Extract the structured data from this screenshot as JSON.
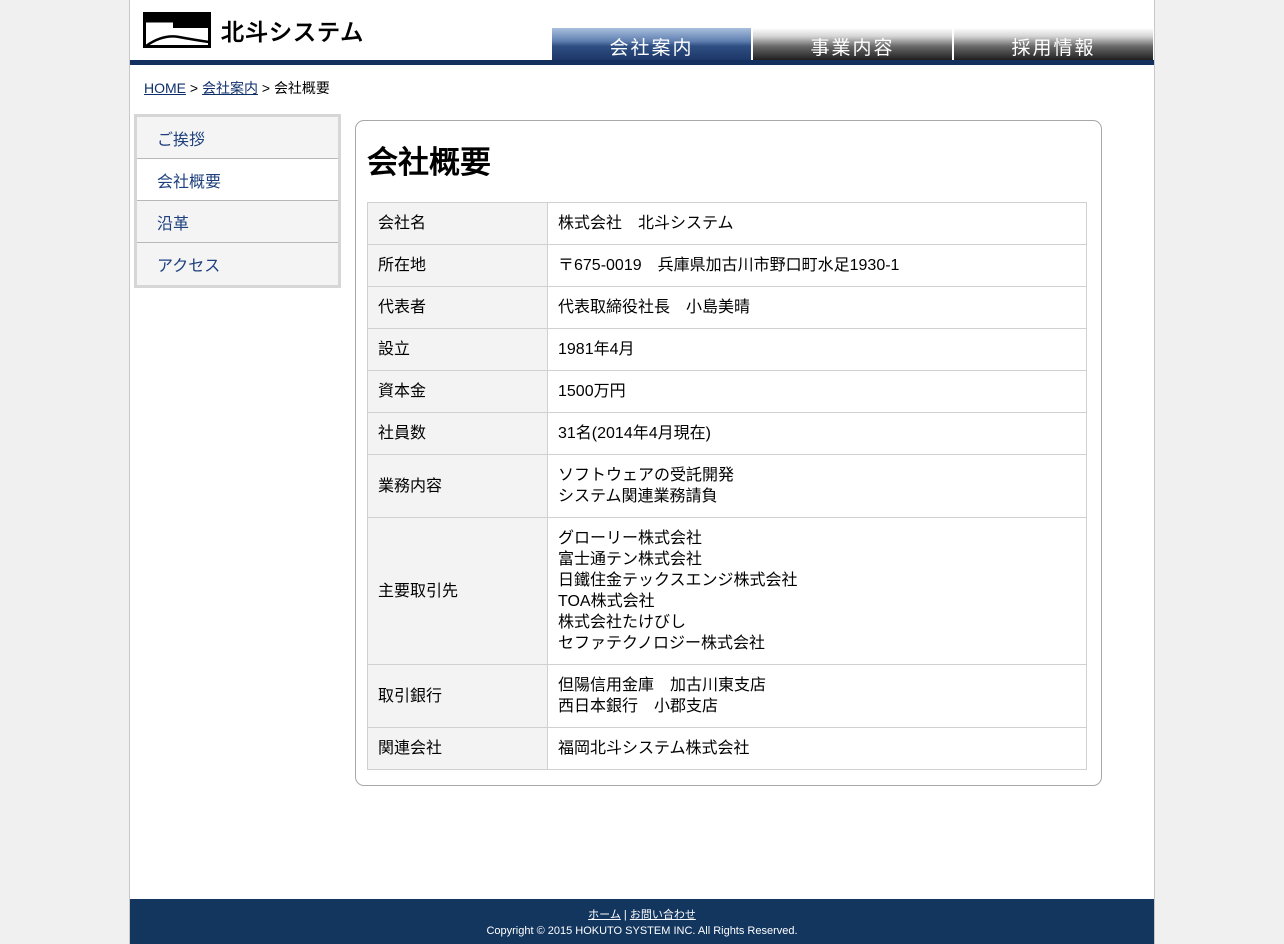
{
  "header": {
    "logo_text": "北斗システム",
    "nav": [
      {
        "label": "会社案内",
        "active": true
      },
      {
        "label": "事業内容",
        "active": false
      },
      {
        "label": "採用情報",
        "active": false
      }
    ]
  },
  "breadcrumb": {
    "home": "HOME",
    "sep": ">",
    "parent": "会社案内",
    "current": "会社概要"
  },
  "sidenav": {
    "items": [
      {
        "label": "ご挨拶"
      },
      {
        "label": "会社概要",
        "current": true
      },
      {
        "label": "沿革"
      },
      {
        "label": "アクセス"
      }
    ]
  },
  "main": {
    "title": "会社概要",
    "rows": [
      {
        "label": "会社名",
        "value": "株式会社　北斗システム"
      },
      {
        "label": "所在地",
        "value": "〒675-0019　兵庫県加古川市野口町水足1930-1"
      },
      {
        "label": "代表者",
        "value": "代表取締役社長　小島美晴"
      },
      {
        "label": "設立",
        "value": "1981年4月"
      },
      {
        "label": "資本金",
        "value": "1500万円"
      },
      {
        "label": "社員数",
        "value": "31名(2014年4月現在)"
      },
      {
        "label": "業務内容",
        "value": "ソフトウェアの受託開発\nシステム関連業務請負"
      },
      {
        "label": "主要取引先",
        "value": "グローリー株式会社\n富士通テン株式会社\n日鐵住金テックスエンジ株式会社\nTOA株式会社\n株式会社たけびし\nセファテクノロジー株式会社"
      },
      {
        "label": "取引銀行",
        "value": "但陽信用金庫　加古川東支店\n西日本銀行　小郡支店"
      },
      {
        "label": "関連会社",
        "value": "福岡北斗システム株式会社"
      }
    ]
  },
  "footer": {
    "home": "ホーム",
    "sep": "|",
    "contact": "お問い合わせ",
    "copyright": "Copyright © 2015 HOKUTO SYSTEM INC. All Rights Reserved."
  },
  "colors": {
    "navy": "#13365f",
    "link": "#1d3f7e"
  }
}
